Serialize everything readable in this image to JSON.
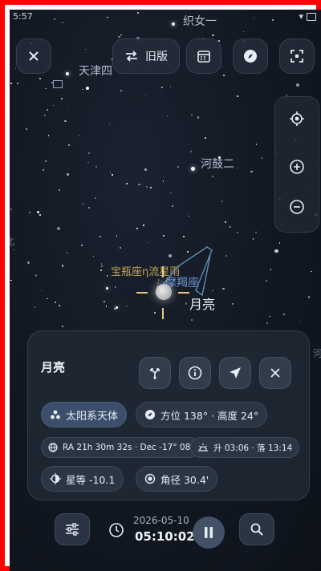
{
  "statusbar": {
    "time": "5:57"
  },
  "toolbar": {
    "close_icon": "close-icon",
    "legacy_label": "旧版",
    "swap_icon": "swap-arrows-icon",
    "calendar_icon": "calendar-icon",
    "compass_icon": "compass-icon",
    "scan_icon": "scan-icon"
  },
  "sky": {
    "labels": {
      "top_label": "织女一",
      "tianjin": "天津四",
      "hegu": "河鼓二",
      "meteor": "宝瓶座η流星雨",
      "constellation": "摩羯座",
      "moon": "月亮",
      "edge_left": "北",
      "edge_right": "河"
    }
  },
  "zoom": {
    "locate_icon": "locate-icon",
    "zoom_in_icon": "plus-circle-icon",
    "zoom_out_icon": "minus-circle-icon"
  },
  "card": {
    "title": "月亮",
    "actions": [
      "branch-icon",
      "info-icon",
      "navigate-icon",
      "close-icon"
    ],
    "category": "太阳系天体",
    "position": "方位 138° · 高度 24°",
    "radec": "RA 21h 30m 32s · Dec -17° 08'",
    "rise_set": "升 03:06 · 落 13:14",
    "magnitude": "星等 -10.1",
    "angular_size": "角径 30.4'"
  },
  "bottom": {
    "date": "2026-05-10",
    "time": "05:10:02",
    "filter_icon": "sliders-icon",
    "clock_icon": "clock-icon",
    "pause_icon": "pause-icon",
    "search_icon": "search-icon"
  },
  "colors": {
    "accent": "#5b7fb0",
    "frame": "#ff0000",
    "panel": "#1e2632"
  }
}
